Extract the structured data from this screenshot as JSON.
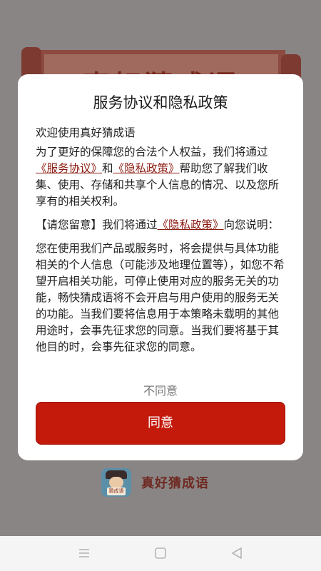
{
  "background": {
    "banner_title": "真好猜成语",
    "app_name": "真好猜成语",
    "logo_tag": "猜成语"
  },
  "dialog": {
    "title": "服务协议和隐私政策",
    "greeting": "欢迎使用真好猜成语",
    "p1_a": "为了更好的保障您的合法个人权益，我们将通过",
    "p1_link1": "《服务协议》",
    "p1_b": "和",
    "p1_link2": "《隐私政策》",
    "p1_c": "帮助您了解我们收集、使用、存储和共享个人信息的情况、以及您所享有的相关权利。",
    "p2_a": "【请您留意】我们将通过",
    "p2_link": "《隐私政策》",
    "p2_b": "向您说明：",
    "p3": "您在使用我们产品或服务时，将会提供与具体功能相关的个人信息（可能涉及地理位置等），如您不希望开启相关功能，可停止使用对应的服务无关的功能，畅快猜成语将不会开启与用户使用的服务无关的功能。当我们要将信息用于本策略未载明的其他用途时，会事先征求您的同意。当我们要将基于其他目的时，会事先征求您的同意。",
    "disagree_label": "不同意",
    "agree_label": "同意"
  },
  "colors": {
    "accent": "#c41a0c",
    "link": "#8b1a10",
    "overlay": "#8a8585"
  },
  "icons": {
    "nav_menu": "menu-icon",
    "nav_home": "home-icon",
    "nav_back": "back-icon"
  }
}
